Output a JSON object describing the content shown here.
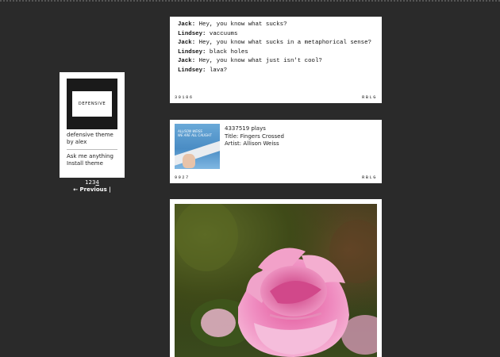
{
  "sidebar": {
    "logo_text": "DEFENSIVE",
    "description": "defensive theme by alex",
    "links": [
      "Ask me anything",
      "Install theme"
    ]
  },
  "pagination": {
    "pages": [
      "1",
      "2",
      "3",
      "4"
    ],
    "current": "4",
    "previous_label": "← Previous |"
  },
  "posts": [
    {
      "type": "chat",
      "lines": [
        {
          "speaker": "Jack:",
          "text": "Hey, you know what sucks?"
        },
        {
          "speaker": "Lindsey:",
          "text": "vaccuums"
        },
        {
          "speaker": "Jack:",
          "text": "Hey, you know what sucks in a metaphorical sense?"
        },
        {
          "speaker": "Lindsey:",
          "text": "black holes"
        },
        {
          "speaker": "Jack:",
          "text": "Hey, you know what just isn't cool?"
        },
        {
          "speaker": "Lindsey:",
          "text": "lava?"
        }
      ],
      "notes": "30186",
      "reblog": "RBLG"
    },
    {
      "type": "audio",
      "album_art_text": "ALLISON WEISS\nWE ARE ALL CAUGHT",
      "plays": "4337519 plays",
      "title": "Title: Fingers Crossed",
      "artist": "Artist: Allison Weiss",
      "notes": "9927",
      "reblog": "RBLG"
    },
    {
      "type": "photo",
      "subject": "pink-peony-flower"
    }
  ]
}
